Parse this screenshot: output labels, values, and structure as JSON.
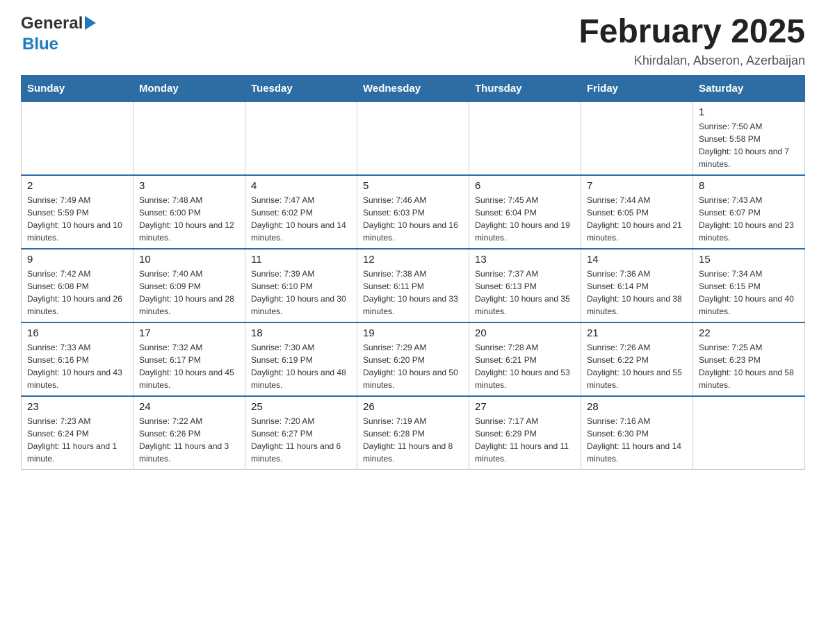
{
  "logo": {
    "general": "General",
    "blue": "Blue"
  },
  "title": {
    "month": "February 2025",
    "location": "Khirdalan, Abseron, Azerbaijan"
  },
  "weekdays": [
    "Sunday",
    "Monday",
    "Tuesday",
    "Wednesday",
    "Thursday",
    "Friday",
    "Saturday"
  ],
  "weeks": [
    [
      {
        "day": "",
        "info": ""
      },
      {
        "day": "",
        "info": ""
      },
      {
        "day": "",
        "info": ""
      },
      {
        "day": "",
        "info": ""
      },
      {
        "day": "",
        "info": ""
      },
      {
        "day": "",
        "info": ""
      },
      {
        "day": "1",
        "info": "Sunrise: 7:50 AM\nSunset: 5:58 PM\nDaylight: 10 hours and 7 minutes."
      }
    ],
    [
      {
        "day": "2",
        "info": "Sunrise: 7:49 AM\nSunset: 5:59 PM\nDaylight: 10 hours and 10 minutes."
      },
      {
        "day": "3",
        "info": "Sunrise: 7:48 AM\nSunset: 6:00 PM\nDaylight: 10 hours and 12 minutes."
      },
      {
        "day": "4",
        "info": "Sunrise: 7:47 AM\nSunset: 6:02 PM\nDaylight: 10 hours and 14 minutes."
      },
      {
        "day": "5",
        "info": "Sunrise: 7:46 AM\nSunset: 6:03 PM\nDaylight: 10 hours and 16 minutes."
      },
      {
        "day": "6",
        "info": "Sunrise: 7:45 AM\nSunset: 6:04 PM\nDaylight: 10 hours and 19 minutes."
      },
      {
        "day": "7",
        "info": "Sunrise: 7:44 AM\nSunset: 6:05 PM\nDaylight: 10 hours and 21 minutes."
      },
      {
        "day": "8",
        "info": "Sunrise: 7:43 AM\nSunset: 6:07 PM\nDaylight: 10 hours and 23 minutes."
      }
    ],
    [
      {
        "day": "9",
        "info": "Sunrise: 7:42 AM\nSunset: 6:08 PM\nDaylight: 10 hours and 26 minutes."
      },
      {
        "day": "10",
        "info": "Sunrise: 7:40 AM\nSunset: 6:09 PM\nDaylight: 10 hours and 28 minutes."
      },
      {
        "day": "11",
        "info": "Sunrise: 7:39 AM\nSunset: 6:10 PM\nDaylight: 10 hours and 30 minutes."
      },
      {
        "day": "12",
        "info": "Sunrise: 7:38 AM\nSunset: 6:11 PM\nDaylight: 10 hours and 33 minutes."
      },
      {
        "day": "13",
        "info": "Sunrise: 7:37 AM\nSunset: 6:13 PM\nDaylight: 10 hours and 35 minutes."
      },
      {
        "day": "14",
        "info": "Sunrise: 7:36 AM\nSunset: 6:14 PM\nDaylight: 10 hours and 38 minutes."
      },
      {
        "day": "15",
        "info": "Sunrise: 7:34 AM\nSunset: 6:15 PM\nDaylight: 10 hours and 40 minutes."
      }
    ],
    [
      {
        "day": "16",
        "info": "Sunrise: 7:33 AM\nSunset: 6:16 PM\nDaylight: 10 hours and 43 minutes."
      },
      {
        "day": "17",
        "info": "Sunrise: 7:32 AM\nSunset: 6:17 PM\nDaylight: 10 hours and 45 minutes."
      },
      {
        "day": "18",
        "info": "Sunrise: 7:30 AM\nSunset: 6:19 PM\nDaylight: 10 hours and 48 minutes."
      },
      {
        "day": "19",
        "info": "Sunrise: 7:29 AM\nSunset: 6:20 PM\nDaylight: 10 hours and 50 minutes."
      },
      {
        "day": "20",
        "info": "Sunrise: 7:28 AM\nSunset: 6:21 PM\nDaylight: 10 hours and 53 minutes."
      },
      {
        "day": "21",
        "info": "Sunrise: 7:26 AM\nSunset: 6:22 PM\nDaylight: 10 hours and 55 minutes."
      },
      {
        "day": "22",
        "info": "Sunrise: 7:25 AM\nSunset: 6:23 PM\nDaylight: 10 hours and 58 minutes."
      }
    ],
    [
      {
        "day": "23",
        "info": "Sunrise: 7:23 AM\nSunset: 6:24 PM\nDaylight: 11 hours and 1 minute."
      },
      {
        "day": "24",
        "info": "Sunrise: 7:22 AM\nSunset: 6:26 PM\nDaylight: 11 hours and 3 minutes."
      },
      {
        "day": "25",
        "info": "Sunrise: 7:20 AM\nSunset: 6:27 PM\nDaylight: 11 hours and 6 minutes."
      },
      {
        "day": "26",
        "info": "Sunrise: 7:19 AM\nSunset: 6:28 PM\nDaylight: 11 hours and 8 minutes."
      },
      {
        "day": "27",
        "info": "Sunrise: 7:17 AM\nSunset: 6:29 PM\nDaylight: 11 hours and 11 minutes."
      },
      {
        "day": "28",
        "info": "Sunrise: 7:16 AM\nSunset: 6:30 PM\nDaylight: 11 hours and 14 minutes."
      },
      {
        "day": "",
        "info": ""
      }
    ]
  ]
}
